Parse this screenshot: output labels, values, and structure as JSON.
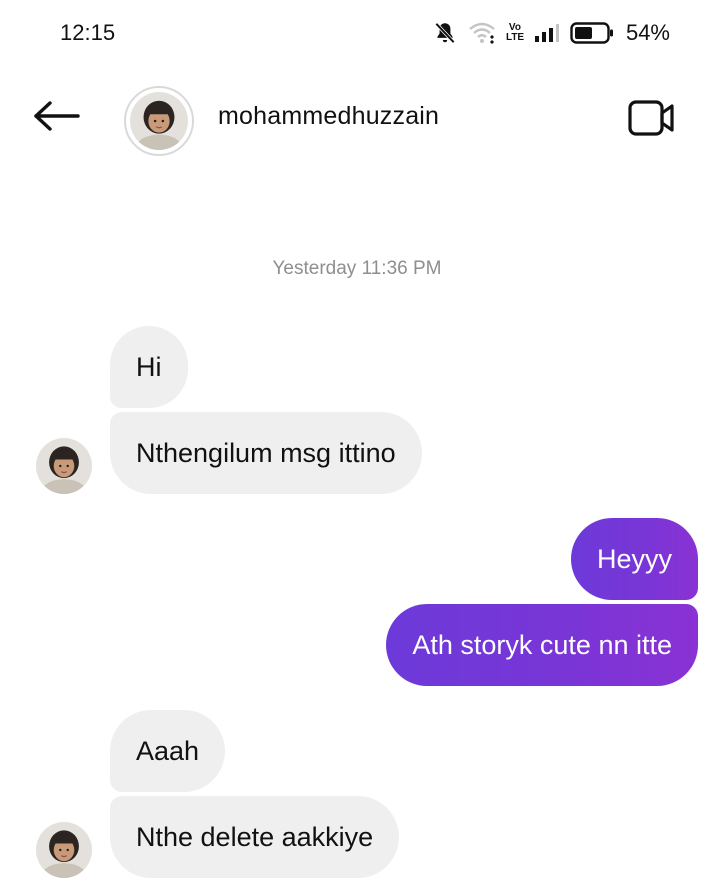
{
  "status_bar": {
    "time": "12:15",
    "network_label": "Vo\nLTE",
    "battery_percent": "54%",
    "icons": [
      "bell-muted-icon",
      "wifi-icon",
      "volte-icon",
      "signal-icon",
      "battery-icon"
    ]
  },
  "header": {
    "username": "mohammedhuzzain",
    "icons": [
      "back-arrow-icon",
      "video-camera-icon"
    ]
  },
  "conversation": {
    "timestamp": "Yesterday 11:36 PM",
    "messages": [
      {
        "from": "them",
        "text": "Hi"
      },
      {
        "from": "them",
        "text": "Nthengilum msg ittino"
      },
      {
        "from": "me",
        "text": "Heyyy"
      },
      {
        "from": "me",
        "text": "Ath storyk cute nn itte"
      },
      {
        "from": "them",
        "text": "Aaah"
      },
      {
        "from": "them",
        "text": "Nthe delete aakkiye"
      }
    ]
  },
  "colors": {
    "incoming_bubble": "#efefef",
    "outgoing_bubble_start": "#6c3ad9",
    "outgoing_bubble_end": "#8a32d4",
    "timestamp": "#8e8e8e"
  }
}
